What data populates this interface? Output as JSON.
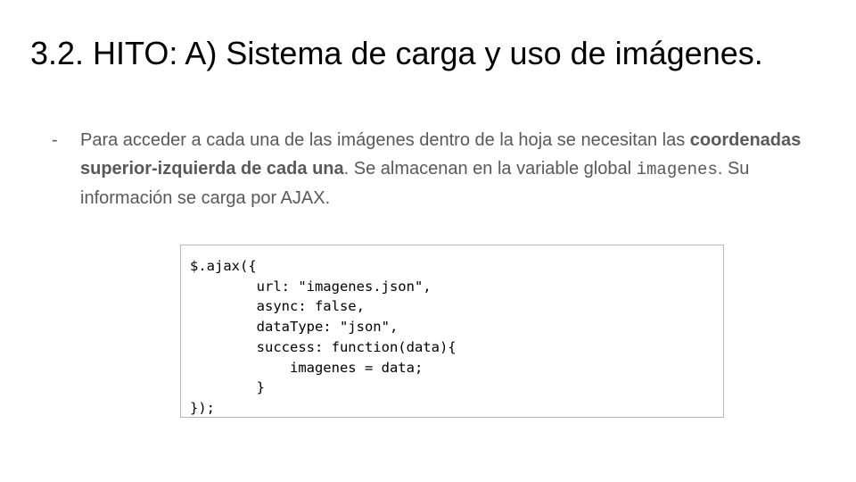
{
  "slide": {
    "title": "3.2. HITO:  A) Sistema de carga y uso de imágenes."
  },
  "bullet": {
    "marker": "-",
    "text_1": "Para acceder a cada una de las imágenes dentro de la hoja se necesitan las ",
    "bold": "coordenadas superior-izquierda de cada una",
    "text_2": ". Se almacenan en la variable global ",
    "code": "imagenes",
    "text_3": ". Su información se carga por AJAX."
  },
  "code_block": {
    "content": "$.ajax({\n        url: \"imagenes.json\",\n        async: false,\n        dataType: \"json\",\n        success: function(data){\n            imagenes = data;\n        }\n});"
  }
}
